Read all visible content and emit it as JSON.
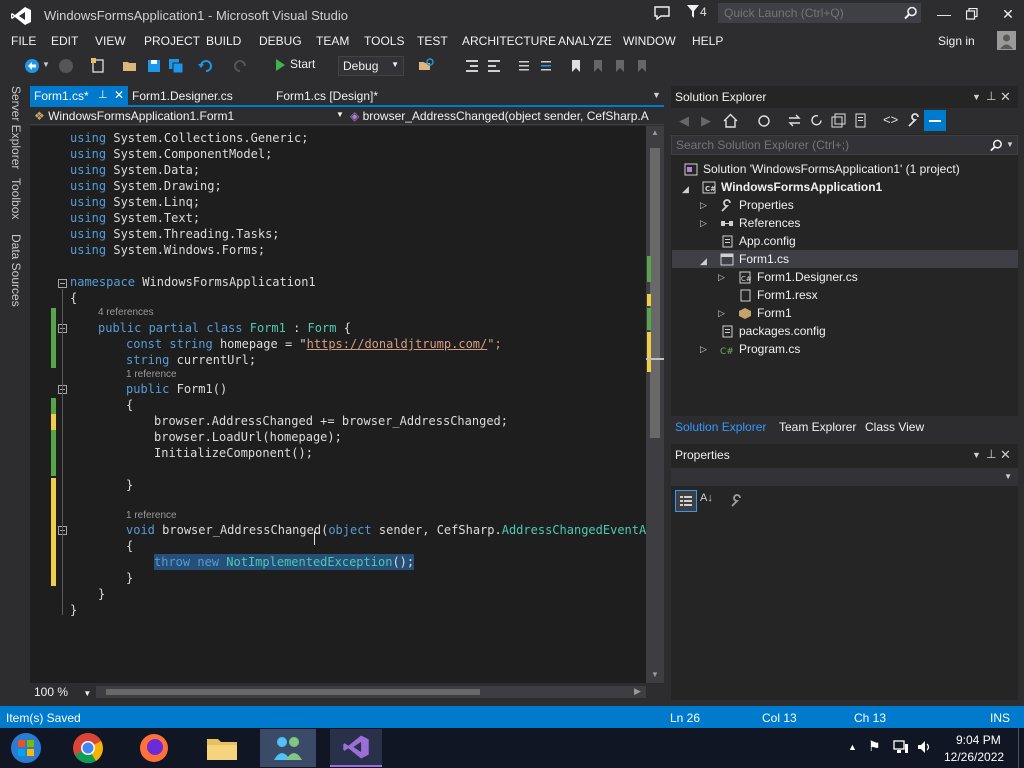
{
  "window": {
    "title": "WindowsFormsApplication1 - Microsoft Visual Studio",
    "notification_count": "4",
    "quick_launch_placeholder": "Quick Launch (Ctrl+Q)"
  },
  "menu": [
    "FILE",
    "EDIT",
    "VIEW",
    "PROJECT",
    "BUILD",
    "DEBUG",
    "TEAM",
    "TOOLS",
    "TEST",
    "ARCHITECTURE",
    "ANALYZE",
    "WINDOW",
    "HELP"
  ],
  "account": {
    "sign_in": "Sign in"
  },
  "toolbar": {
    "start_label": "Start",
    "config": "Debug"
  },
  "side_tabs": [
    "Server Explorer",
    "Toolbox",
    "Data Sources"
  ],
  "doc_tabs": [
    "Form1.cs*",
    "Form1.Designer.cs",
    "Form1.cs [Design]*"
  ],
  "nav": {
    "class": "WindowsFormsApplication1.Form1",
    "member": "browser_AddressChanged(object sender, CefSharp.A"
  },
  "code": {
    "usings": [
      "System.Collections.Generic;",
      "System.ComponentModel;",
      "System.Data;",
      "System.Drawing;",
      "System.Linq;",
      "System.Text;",
      "System.Threading.Tasks;",
      "System.Windows.Forms;"
    ],
    "namespace_kw": "namespace",
    "namespace_name": "WindowsFormsApplication1",
    "ref_4": "4 references",
    "ref_1": "1 reference",
    "class_kw": "public partial class",
    "class_name": "Form1",
    "class_base": "Form",
    "homepage_decl": "const string",
    "homepage_name": "homepage = \"",
    "homepage_url": "https://donaldjtrump.com/",
    "homepage_end": "\";",
    "current_url_kw": "string",
    "current_url_name": "currentUrl;",
    "ctor_kw": "public",
    "ctor_name": "Form1()",
    "body1": "browser.AddressChanged += browser_AddressChanged;",
    "body2": "browser.LoadUrl(homepage);",
    "body3": "InitializeComponent();",
    "handler_kw": "void",
    "handler_name": "browser_AddressChanged(",
    "handler_obj_kw": "object",
    "handler_params": "sender, CefSharp.",
    "handler_type": "AddressChangedEventArgs",
    "throw_kw": "throw new",
    "throw_type": "NotImplementedException",
    "throw_end": "();",
    "using_kw": "using",
    "brace_open": "{",
    "brace_close": "}",
    "class_open": "{"
  },
  "zoom": "100 %",
  "solution_explorer": {
    "title": "Solution Explorer",
    "search_placeholder": "Search Solution Explorer (Ctrl+;)",
    "tree": [
      {
        "label": "Solution 'WindowsFormsApplication1' (1 project)",
        "icon": "solution-icon"
      },
      {
        "label": "WindowsFormsApplication1",
        "icon": "csharp-project-icon"
      },
      {
        "label": "Properties",
        "icon": "wrench-icon"
      },
      {
        "label": "References",
        "icon": "references-icon"
      },
      {
        "label": "App.config",
        "icon": "config-file-icon"
      },
      {
        "label": "Form1.cs",
        "icon": "form-icon"
      },
      {
        "label": "Form1.Designer.cs",
        "icon": "csharp-file-icon"
      },
      {
        "label": "Form1.resx",
        "icon": "resx-file-icon"
      },
      {
        "label": "Form1",
        "icon": "class-icon"
      },
      {
        "label": "packages.config",
        "icon": "config-file-icon"
      },
      {
        "label": "Program.cs",
        "icon": "csharp-file-icon"
      }
    ],
    "bottom_tabs": [
      "Solution Explorer",
      "Team Explorer",
      "Class View"
    ]
  },
  "properties": {
    "title": "Properties"
  },
  "status": {
    "message": "Item(s) Saved",
    "line": "Ln 26",
    "col": "Col 13",
    "ch": "Ch 13",
    "mode": "INS"
  },
  "clock": {
    "time": "9:04 PM",
    "date": "12/26/2022"
  },
  "colors": {
    "accent": "#007acc",
    "editor_bg": "#1e1e1e",
    "chrome_bg": "#2d2d30"
  }
}
